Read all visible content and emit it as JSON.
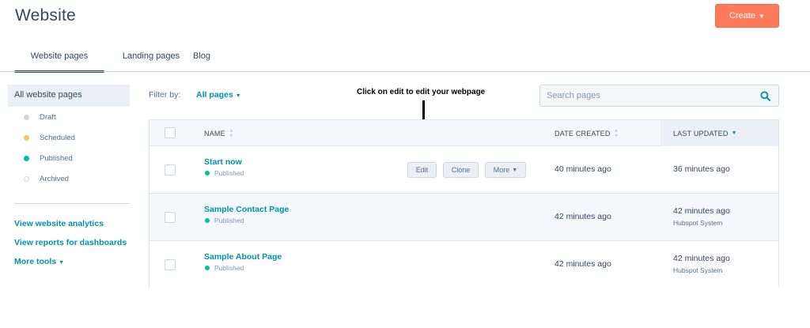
{
  "header": {
    "title": "Website",
    "create_label": "Create"
  },
  "tabs": [
    {
      "label": "Website pages"
    },
    {
      "label": "Landing pages"
    },
    {
      "label": "Blog"
    }
  ],
  "sidebar": {
    "active_label": "All website pages",
    "statuses": [
      {
        "label": "Draft",
        "color": "#cbd6e2"
      },
      {
        "label": "Scheduled",
        "color": "#f5c26b"
      },
      {
        "label": "Published",
        "color": "#00bda5"
      },
      {
        "label": "Archived",
        "color": "#ffffff"
      }
    ],
    "links": [
      {
        "label": "View website analytics"
      },
      {
        "label": "View reports for dashboards"
      },
      {
        "label": "More tools"
      }
    ]
  },
  "filter": {
    "label": "Filter by:",
    "value": "All pages"
  },
  "annotation": {
    "text": "Click on edit to edit your webpage"
  },
  "search": {
    "placeholder": "Search pages"
  },
  "table": {
    "columns": {
      "name": "NAME",
      "date_created": "DATE CREATED",
      "last_updated": "LAST UPDATED"
    },
    "actions": {
      "edit": "Edit",
      "clone": "Clone",
      "more": "More"
    },
    "rows": [
      {
        "name": "Start now",
        "status": "Published",
        "date_created": "40 minutes ago",
        "last_updated": "36 minutes ago",
        "updated_by": ""
      },
      {
        "name": "Sample Contact Page",
        "status": "Published",
        "date_created": "42 minutes ago",
        "last_updated": "42 minutes ago",
        "updated_by": "Hubspot System"
      },
      {
        "name": "Sample About Page",
        "status": "Published",
        "date_created": "42 minutes ago",
        "last_updated": "42 minutes ago",
        "updated_by": "Hubspot System"
      }
    ]
  },
  "colors": {
    "accent": "#ff7a59",
    "link": "#0091ae",
    "text": "#33475b",
    "published": "#00bda5"
  }
}
